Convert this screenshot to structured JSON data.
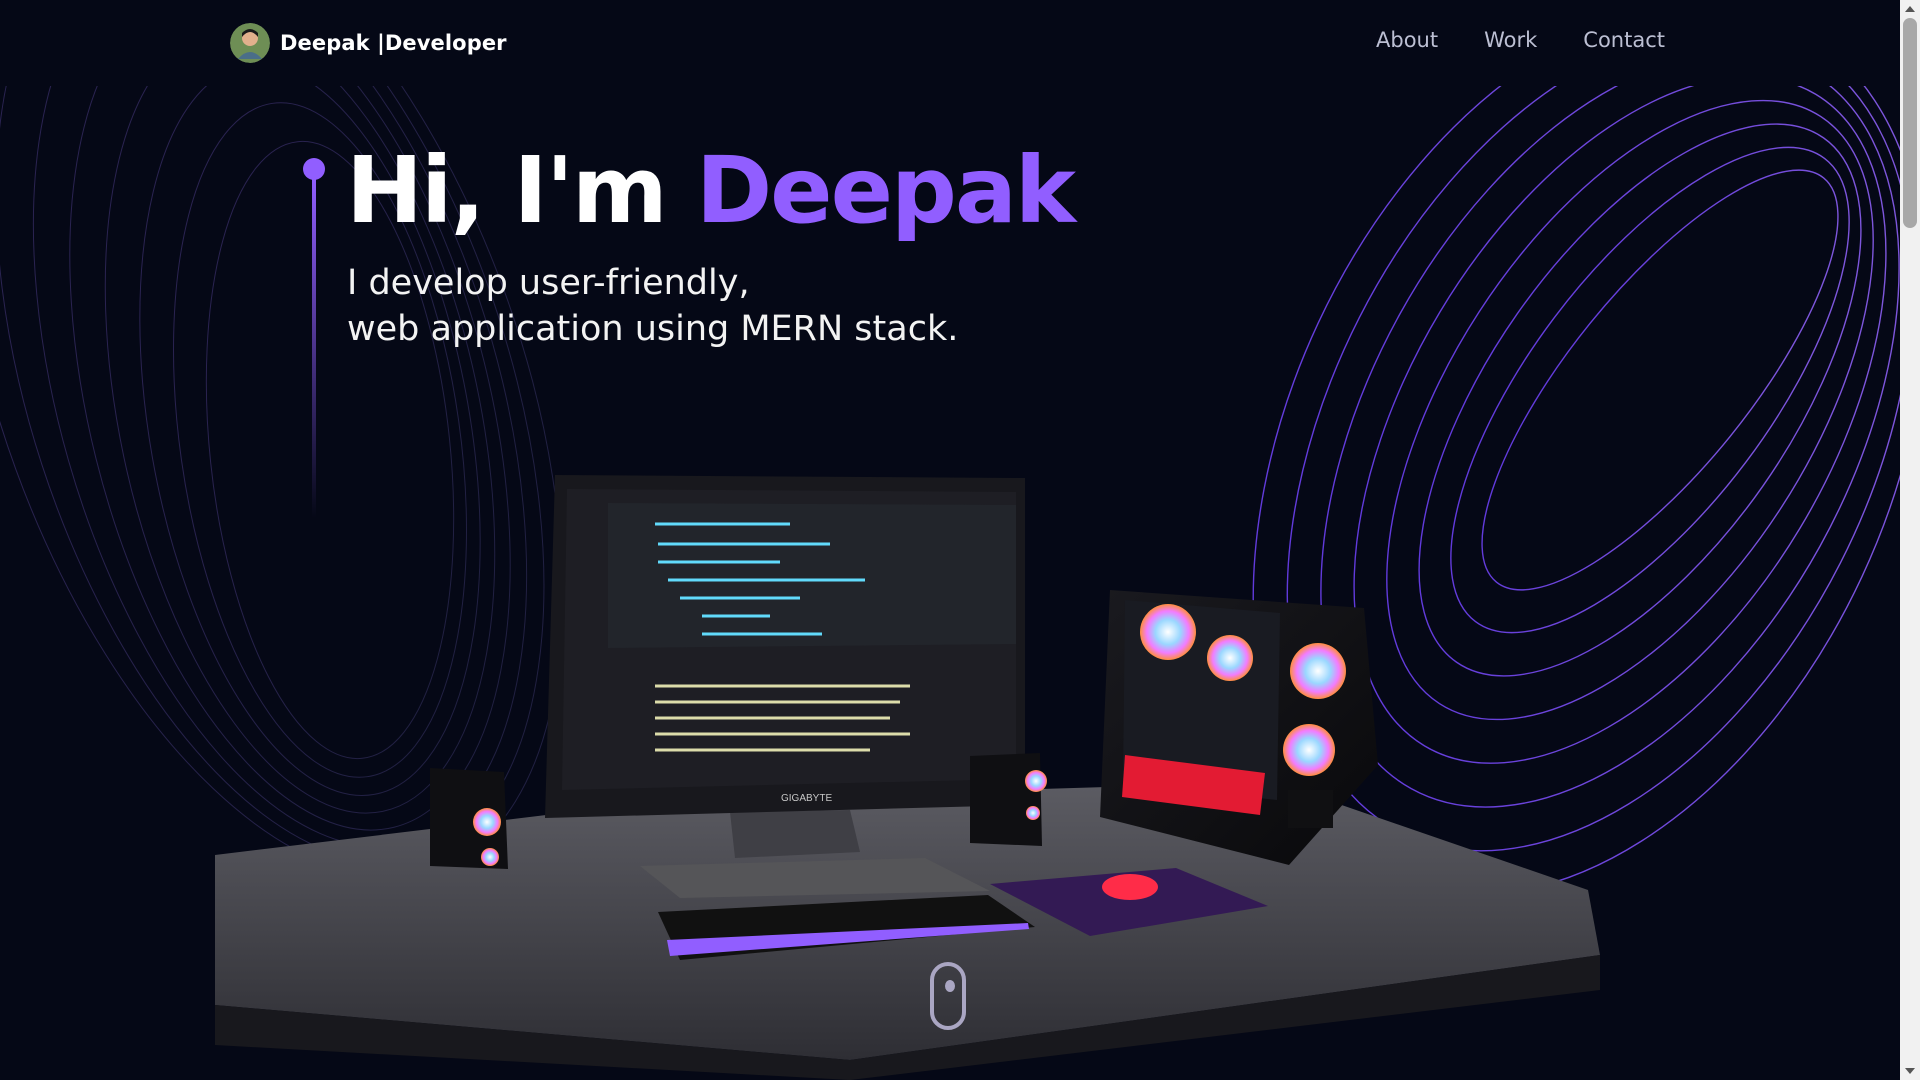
{
  "nav": {
    "brand": "Deepak |Developer",
    "links": [
      "About",
      "Work",
      "Contact"
    ]
  },
  "hero": {
    "greeting": "Hi, I'm ",
    "name": "Deepak",
    "subtitle_lines": [
      "I develop user-friendly,",
      "web application using MERN stack."
    ]
  },
  "monitor_brand": "GIGABYTE",
  "icons": {
    "avatar": "developer-avatar",
    "scroll": "mouse-scroll-icon"
  },
  "colors": {
    "background": "#050816",
    "accent": "#915eff",
    "nav_link": "#bcbfd3",
    "scroll_indicator": "#aaa6c3"
  }
}
